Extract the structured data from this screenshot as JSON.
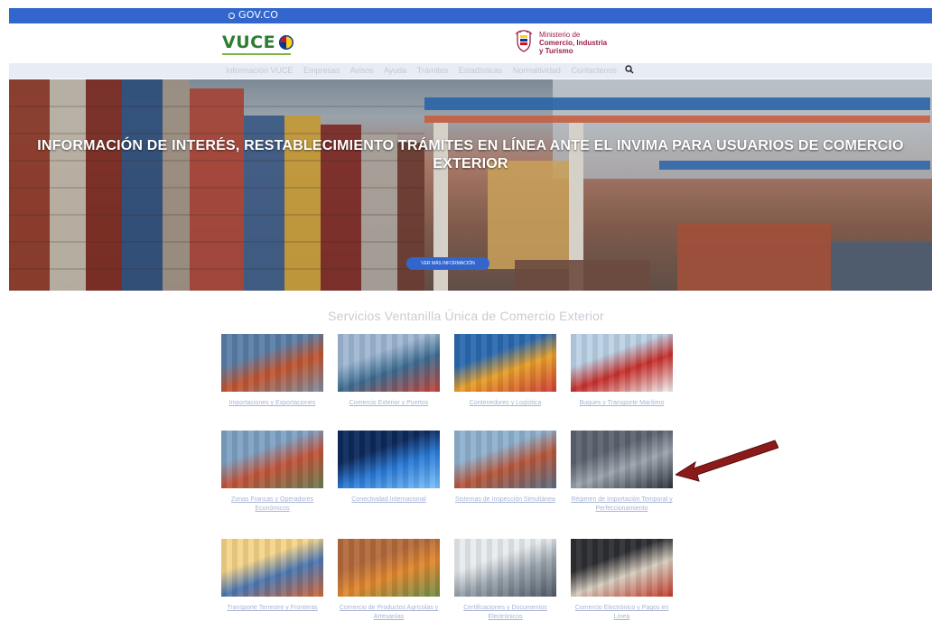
{
  "gov_bar": {
    "label": "GOV.CO"
  },
  "header": {
    "logo_text": "VUCE",
    "ministry": {
      "line1": "Ministerio de",
      "line2": "Comercio, Industria",
      "line3": "y Turismo"
    }
  },
  "nav": {
    "items": [
      "Información VUCE",
      "Empresas",
      "Avisos",
      "Ayuda",
      "Trámites",
      "Estadísticas",
      "Normatividad",
      "Contactenos"
    ]
  },
  "hero": {
    "title": "INFORMACIÓN DE INTERÉS, RESTABLECIMIENTO TRÁMITES EN LÍNEA ANTE EL INVIMA PARA USUARIOS DE COMERCIO EXTERIOR",
    "button_label": "VER MÁS INFORMACIÓN"
  },
  "services": {
    "title": "Servicios Ventanilla Única de Comercio Exterior",
    "cards": [
      {
        "caption": "Importaciones y Exportaciones",
        "palette": "port"
      },
      {
        "caption": "Comercio Exterior y Puertos",
        "palette": "harbor"
      },
      {
        "caption": "Contenedores y Logística",
        "palette": "containers"
      },
      {
        "caption": "Buques y Transporte Marítimo",
        "palette": "ship"
      },
      {
        "caption": "Zonas Francas y Operadores Económicos",
        "palette": "yard"
      },
      {
        "caption": "Conectividad Internacional",
        "palette": "network"
      },
      {
        "caption": "Sistemas de Inspección Simultánea",
        "palette": "terminal"
      },
      {
        "caption": "Régimen de Importación Temporal y Perfeccionamiento",
        "palette": "factory"
      },
      {
        "caption": "Transporte Terrestre y Fronteras",
        "palette": "sunset"
      },
      {
        "caption": "Comercio de Productos Agrícolas y Artesanías",
        "palette": "market"
      },
      {
        "caption": "Certificaciones y Documentos Electrónicos",
        "palette": "office"
      },
      {
        "caption": "Comercio Electrónico y Pagos en Línea",
        "palette": "laptop"
      }
    ]
  },
  "colors": {
    "gov_blue": "#3366cc",
    "link": "#a8b4d6",
    "arrow": "#8b1a1a"
  }
}
